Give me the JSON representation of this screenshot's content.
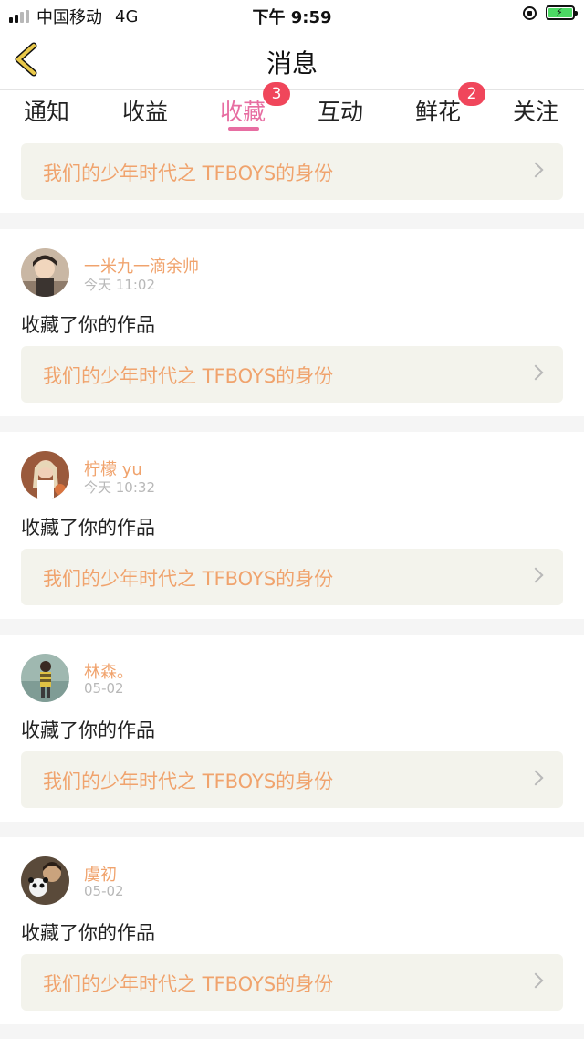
{
  "status_bar": {
    "carrier": "中国移动",
    "network": "4G",
    "time": "下午 9:59"
  },
  "header": {
    "title": "消息",
    "back_icon": "chevron-left-icon",
    "accent_color": "#e9c84a"
  },
  "tabs": [
    {
      "label": "通知",
      "active": false,
      "badge": ""
    },
    {
      "label": "收益",
      "active": false,
      "badge": ""
    },
    {
      "label": "收藏",
      "active": true,
      "badge": "3"
    },
    {
      "label": "互动",
      "active": false,
      "badge": ""
    },
    {
      "label": "鲜花",
      "active": false,
      "badge": "2"
    },
    {
      "label": "关注",
      "active": false,
      "badge": ""
    }
  ],
  "colors": {
    "active_tab": "#e76ea2",
    "badge": "#f0465b",
    "username": "#f0a36d",
    "work_card_bg": "#f3f3ec"
  },
  "top_work": {
    "title": "我们的少年时代之 TFBOYS的身份"
  },
  "messages": [
    {
      "user": "一米九一滴余帅",
      "time": "今天 11:02",
      "action": "收藏了你的作品",
      "work_title": "我们的少年时代之 TFBOYS的身份"
    },
    {
      "user": "柠檬 yu",
      "time": "今天 10:32",
      "action": "收藏了你的作品",
      "work_title": "我们的少年时代之 TFBOYS的身份"
    },
    {
      "user": "林森。",
      "time": "05-02",
      "action": "收藏了你的作品",
      "work_title": "我们的少年时代之 TFBOYS的身份"
    },
    {
      "user": "虞初",
      "time": "05-02",
      "action": "收藏了你的作品",
      "work_title": "我们的少年时代之 TFBOYS的身份"
    }
  ]
}
